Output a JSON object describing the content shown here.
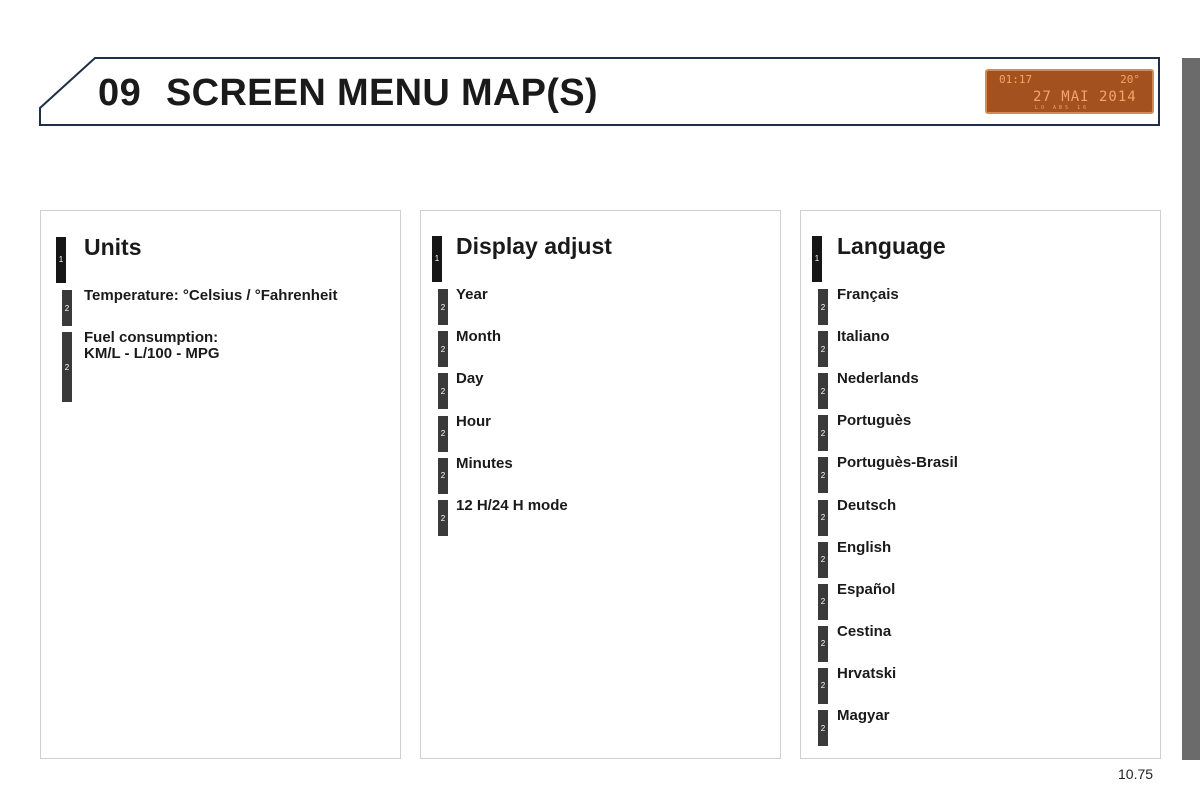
{
  "header": {
    "chapter": "09",
    "title": "SCREEN MENU MAP(S)",
    "display": {
      "time": "01:17",
      "temperature": "20°",
      "date": "27 MAI 2014",
      "status": "LO  ABS  16"
    }
  },
  "panels": [
    {
      "level": "1",
      "title": "Units",
      "items": [
        {
          "level": "2",
          "lines": [
            "Temperature: °Celsius / °Fahrenheit"
          ]
        },
        {
          "level": "2",
          "lines": [
            "Fuel consumption:",
            "KM/L - L/100 - MPG"
          ]
        }
      ]
    },
    {
      "level": "1",
      "title": "Display adjust",
      "items": [
        {
          "level": "2",
          "lines": [
            "Year"
          ]
        },
        {
          "level": "2",
          "lines": [
            "Month"
          ]
        },
        {
          "level": "2",
          "lines": [
            "Day"
          ]
        },
        {
          "level": "2",
          "lines": [
            "Hour"
          ]
        },
        {
          "level": "2",
          "lines": [
            "Minutes"
          ]
        },
        {
          "level": "2",
          "lines": [
            "12 H/24 H mode"
          ]
        }
      ]
    },
    {
      "level": "1",
      "title": "Language",
      "items": [
        {
          "level": "2",
          "lines": [
            "Français"
          ]
        },
        {
          "level": "2",
          "lines": [
            "Italiano"
          ]
        },
        {
          "level": "2",
          "lines": [
            "Nederlands"
          ]
        },
        {
          "level": "2",
          "lines": [
            "Portuguès"
          ]
        },
        {
          "level": "2",
          "lines": [
            "Portuguès-Brasil"
          ]
        },
        {
          "level": "2",
          "lines": [
            "Deutsch"
          ]
        },
        {
          "level": "2",
          "lines": [
            "English"
          ]
        },
        {
          "level": "2",
          "lines": [
            "Español"
          ]
        },
        {
          "level": "2",
          "lines": [
            "Cestina"
          ]
        },
        {
          "level": "2",
          "lines": [
            "Hrvatski"
          ]
        },
        {
          "level": "2",
          "lines": [
            "Magyar"
          ]
        }
      ]
    }
  ],
  "footer": {
    "page_number": "10.75"
  }
}
